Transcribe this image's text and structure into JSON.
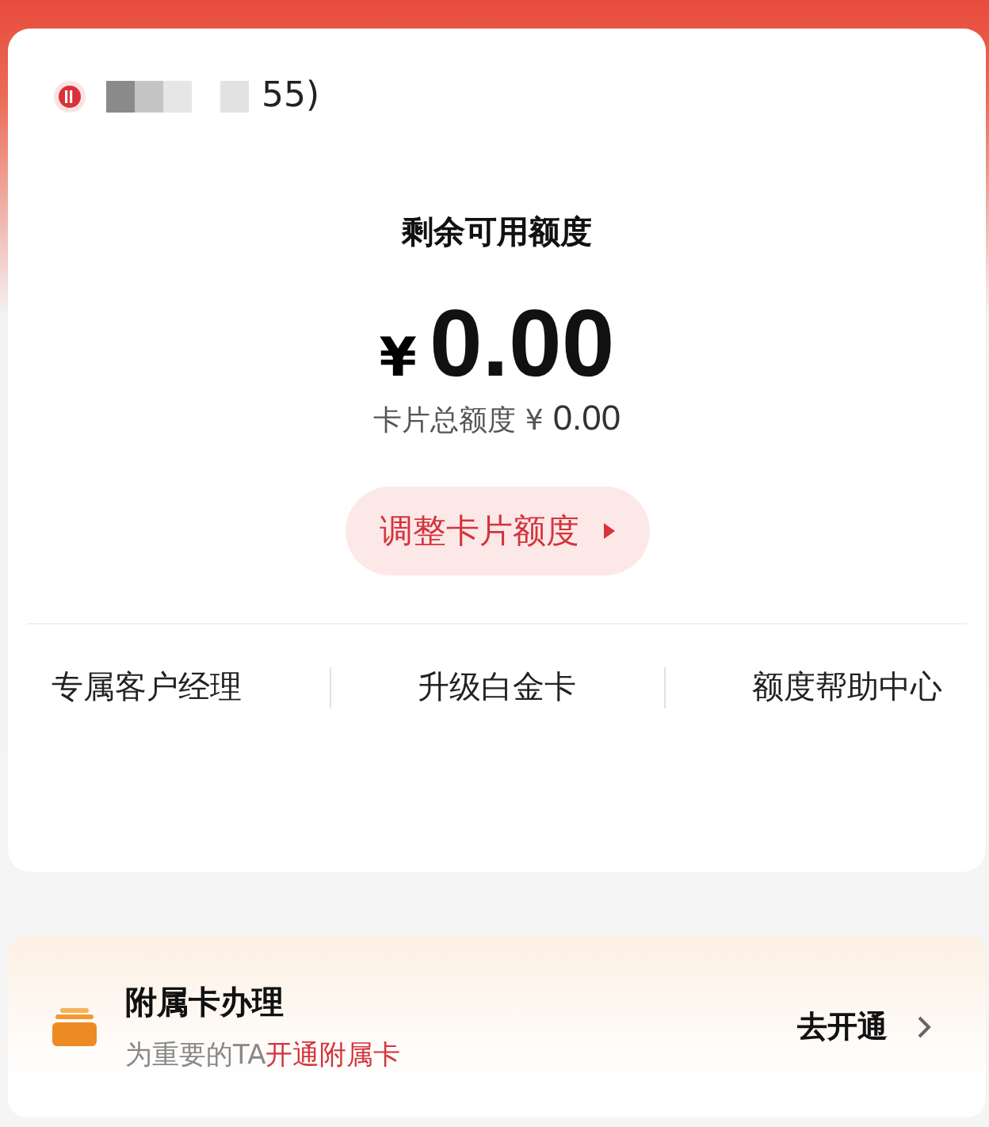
{
  "account": {
    "suffix": "55)"
  },
  "credit": {
    "label": "剩余可用额度",
    "currency": "¥",
    "amount": "0.00",
    "total_label": "卡片总额度",
    "total_currency": "¥",
    "total_amount": "0.00",
    "adjust_button": "调整卡片额度"
  },
  "links": [
    "专属客户经理",
    "升级白金卡",
    "额度帮助中心"
  ],
  "supplementary": {
    "title": "附属卡办理",
    "subtitle": "为重要的TA",
    "subtitle_link": "开通附属卡",
    "action": "去开通"
  }
}
